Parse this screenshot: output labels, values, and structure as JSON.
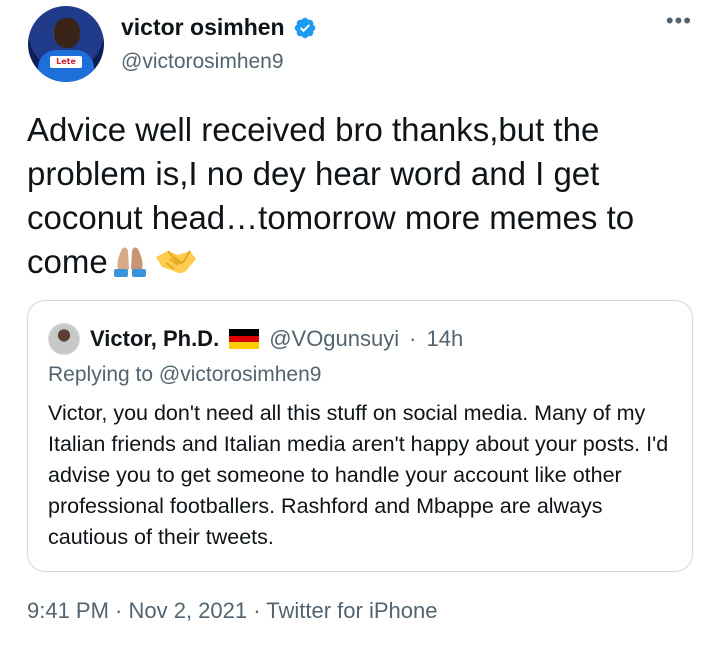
{
  "author": {
    "display_name": "victor osimhen",
    "handle": "@victorosimhen9",
    "avatar_jersey_text": "Lete"
  },
  "icons": {
    "verified": "verified-badge-icon",
    "more": "more-options-icon",
    "flag": "germany-flag-icon",
    "pray": "folded-hands-emoji",
    "handshake": "handshake-emoji"
  },
  "tweet": {
    "text": "Advice well received bro thanks,but the problem is,I no dey hear word and I get coconut head…tomorrow more memes to come"
  },
  "quoted_tweet": {
    "display_name": "Victor, Ph.D.",
    "handle": "@VOgunsuyi",
    "separator": "·",
    "time": "14h",
    "replying_to": "Replying to @victorosimhen9",
    "text": "Victor, you don't need all this stuff on social media. Many of my Italian friends and Italian media aren't happy about your posts. I'd advise you to get someone to handle your account like other professional footballers. Rashford and Mbappe are always cautious of their tweets."
  },
  "footer": {
    "text": "9:41 PM · Nov 2, 2021 · Twitter for iPhone"
  },
  "colors": {
    "text": "#0f1419",
    "secondary": "#536471",
    "verified": "#1d9bf0",
    "border": "#cfd9de"
  }
}
